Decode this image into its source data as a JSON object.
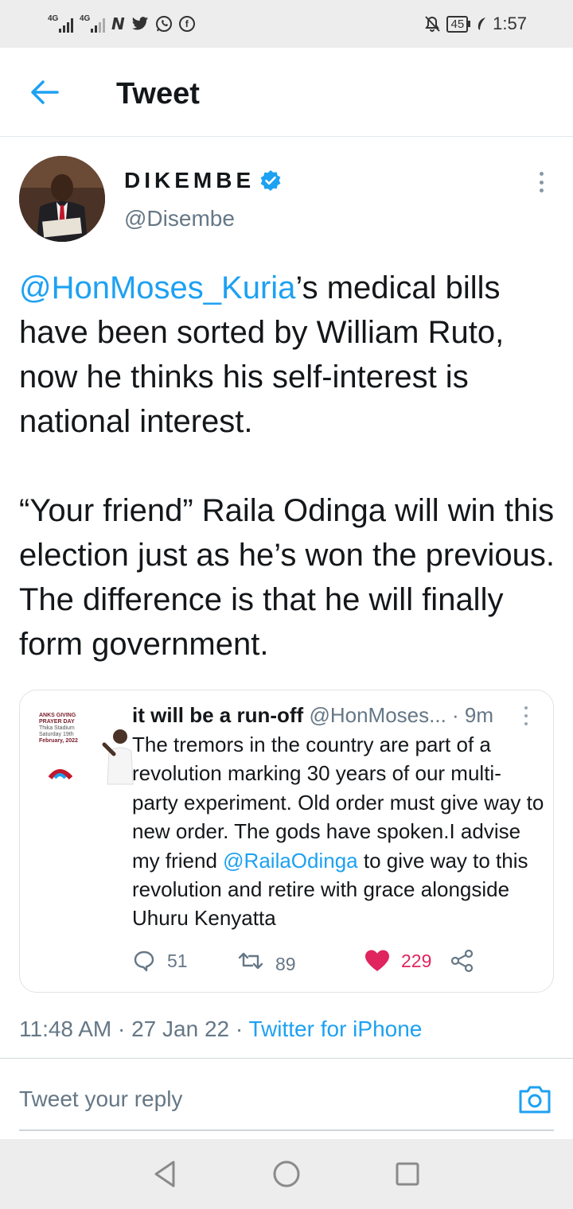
{
  "status_bar": {
    "network_1": "4G",
    "network_2": "4G",
    "app_icons": [
      "netflix-n-icon",
      "twitter-bird-icon",
      "whatsapp-icon",
      "facebook-icon"
    ],
    "mute_icon": "bell-off-icon",
    "battery": "45",
    "time": "1:57"
  },
  "header": {
    "back_icon": "back-arrow-icon",
    "title": "Tweet"
  },
  "tweet": {
    "author_name": "DIKEMBE",
    "verified": true,
    "author_handle": "@Disembe",
    "mention": "@HonMoses_Kuria",
    "text_p1_rest": "’s medical bills have been sorted by William Ruto, now he thinks his self-interest is national interest.",
    "text_p2": "“Your friend” Raila Odinga will win this election just as he’s won the previous. The difference is that he will finally form government.",
    "timestamp": "11:48 AM · 27 Jan 22 ·",
    "source": "Twitter for iPhone"
  },
  "embedded_tweet": {
    "name": "it will be a run-off",
    "handle_time": "@HonMoses... · 9m",
    "thumbnail_text": {
      "line1": "ANKS GIVING",
      "line2": "PRAYER DAY",
      "line3": "Thika Stadium",
      "line4": "Saturday 19th",
      "line5": "February, 2022"
    },
    "text_before": "The tremors in  the country are part of  a revolution marking 30 years of our multi-party experiment. Old order must give way to new order. The gods have spoken.I advise my friend ",
    "mention": "@RailaOdinga",
    "text_after": " to give way to this revolution and retire with grace alongside Uhuru Kenyatta",
    "replies": "51",
    "retweets": "89",
    "likes": "229",
    "colors": {
      "like": "#e0245e",
      "muted": "#657786"
    }
  },
  "reply": {
    "placeholder": "Tweet your reply",
    "camera_icon": "camera-icon"
  },
  "nav_bar": {
    "back": "nav-back-icon",
    "home": "nav-home-icon",
    "recents": "nav-recents-icon"
  },
  "colors": {
    "accent": "#1da1f2",
    "text": "#14171a",
    "muted": "#657786",
    "system_bar": "#ededed"
  }
}
